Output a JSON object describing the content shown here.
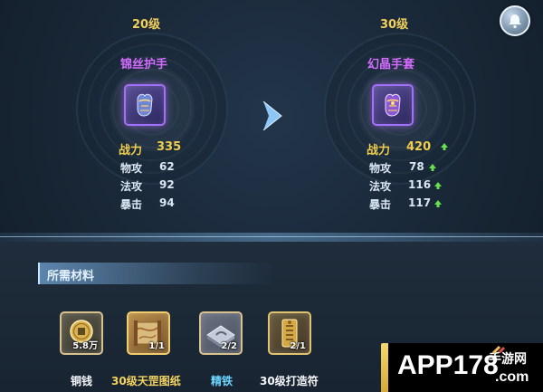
{
  "compare": {
    "left": {
      "level": "20级",
      "name": "锦丝护手",
      "power_label": "战力",
      "power": "335",
      "stats": [
        {
          "label": "物攻",
          "value": "62"
        },
        {
          "label": "法攻",
          "value": "92"
        },
        {
          "label": "暴击",
          "value": "94"
        }
      ]
    },
    "right": {
      "level": "30级",
      "name": "幻晶手套",
      "power_label": "战力",
      "power": "420",
      "stats": [
        {
          "label": "物攻",
          "value": "78"
        },
        {
          "label": "法攻",
          "value": "116"
        },
        {
          "label": "暴击",
          "value": "117"
        }
      ]
    }
  },
  "materials": {
    "title": "所需材料",
    "items": [
      {
        "name": "铜钱",
        "count": "5.8万"
      },
      {
        "name": "30级天罡图纸",
        "count": "1/1"
      },
      {
        "name": "精铁",
        "count": "2/2"
      },
      {
        "name": "30级打造符",
        "count": "2/1"
      }
    ]
  },
  "watermark": {
    "brand": "APP178",
    "cn": "手游网",
    "domain": ".com"
  },
  "icons": {
    "notify": "bell-icon",
    "arrow": "chevron-right-icon",
    "stat_up": "up-arrow-icon",
    "coin": "coin-icon",
    "scroll": "blueprint-scroll-icon",
    "iron": "iron-ingot-icon",
    "talisman": "talisman-icon"
  }
}
